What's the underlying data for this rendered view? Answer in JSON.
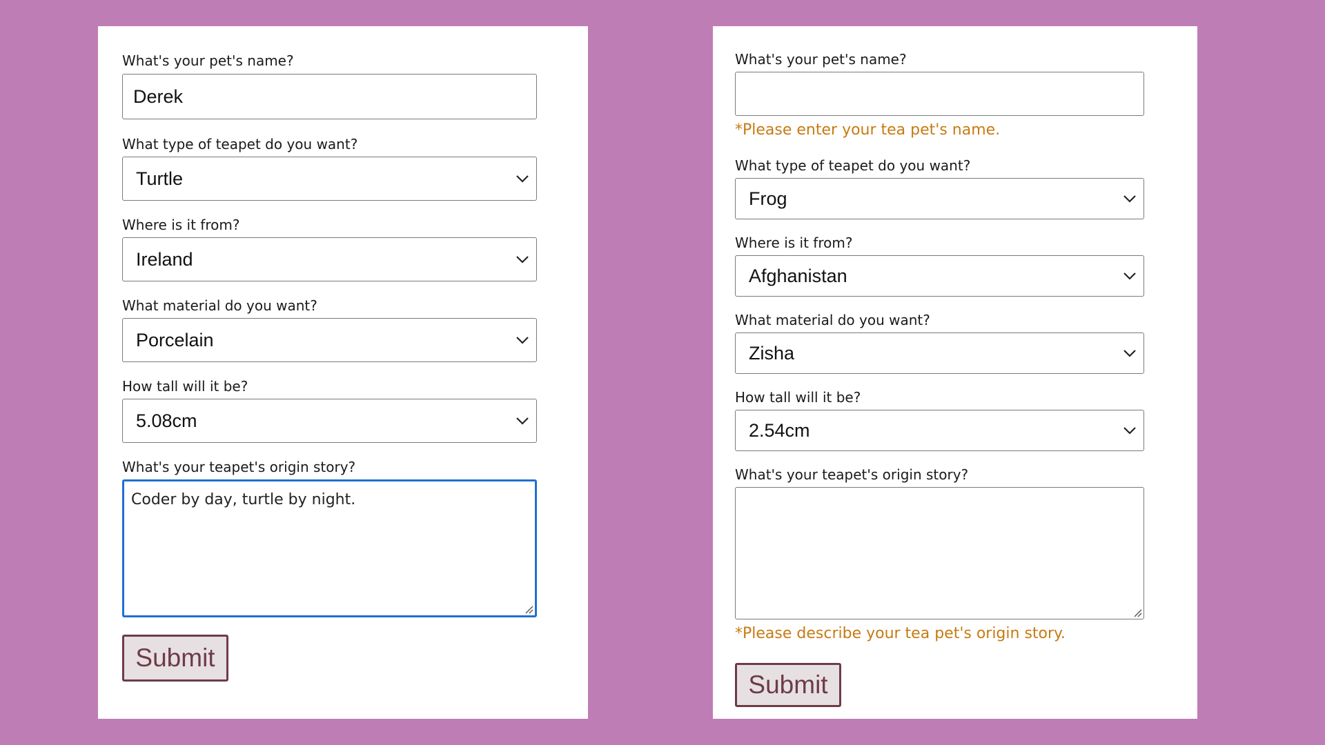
{
  "forms": {
    "left": {
      "name_label": "What's your pet's name?",
      "name_value": "Derek",
      "type_label": "What type of teapet do you want?",
      "type_value": "Turtle",
      "origin_label": "Where is it from?",
      "origin_value": "Ireland",
      "material_label": "What material do you want?",
      "material_value": "Porcelain",
      "height_label": "How tall will it be?",
      "height_value": "5.08cm",
      "story_label": "What's your teapet's origin story?",
      "story_value": "Coder by day, turtle by night.",
      "submit_label": "Submit"
    },
    "right": {
      "name_label": "What's your pet's name?",
      "name_value": "",
      "name_error": "*Please enter your tea pet's name.",
      "type_label": "What type of teapet do you want?",
      "type_value": "Frog",
      "origin_label": "Where is it from?",
      "origin_value": "Afghanistan",
      "material_label": "What material do you want?",
      "material_value": "Zisha",
      "height_label": "How tall will it be?",
      "height_value": "2.54cm",
      "story_label": "What's your teapet's origin story?",
      "story_value": "",
      "story_error": "*Please describe your tea pet's origin story.",
      "submit_label": "Submit"
    }
  },
  "colors": {
    "background": "#bf7db6",
    "card": "#ffffff",
    "error": "#c77a12",
    "focus_border": "#1f6fd1",
    "submit_border": "#6e3b48",
    "submit_fill": "#e6e0e2"
  },
  "icons": {
    "select_arrow": "chevron-down-icon",
    "textarea_resize": "resize-grip-icon"
  }
}
